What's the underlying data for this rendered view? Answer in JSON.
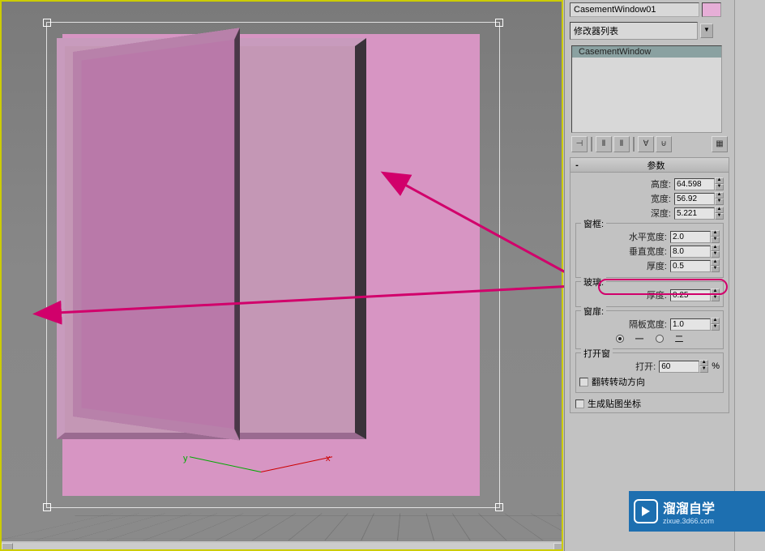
{
  "object_name": "CasementWindow01",
  "modifier_list_label": "修改器列表",
  "stack_item": "CasementWindow",
  "rollout": {
    "title": "参数"
  },
  "dims": {
    "height_label": "高度:",
    "height": "64.598",
    "width_label": "宽度:",
    "width": "56.92",
    "depth_label": "深度:",
    "depth": "5.221"
  },
  "frame": {
    "group": "窗框:",
    "hwidth_label": "水平宽度:",
    "hwidth": "2.0",
    "vwidth_label": "垂直宽度:",
    "vwidth": "8.0",
    "thick_label": "厚度:",
    "thick": "0.5"
  },
  "glass": {
    "group": "玻璃:",
    "thick_label": "厚度:",
    "thick": "0.25"
  },
  "sash": {
    "group": "窗扉:",
    "divwidth_label": "隔板宽度:",
    "divwidth": "1.0",
    "radio1": "一",
    "radio2": "二"
  },
  "open": {
    "group": "打开窗",
    "open_label": "打开:",
    "open": "60",
    "pct": "%",
    "flip_label": "翻转转动方向"
  },
  "mapcoords_label": "生成贴图坐标",
  "gizmo": {
    "x": "x",
    "y": "y"
  },
  "watermark": {
    "brand": "溜溜自学",
    "url": "zixue.3d66.com"
  }
}
